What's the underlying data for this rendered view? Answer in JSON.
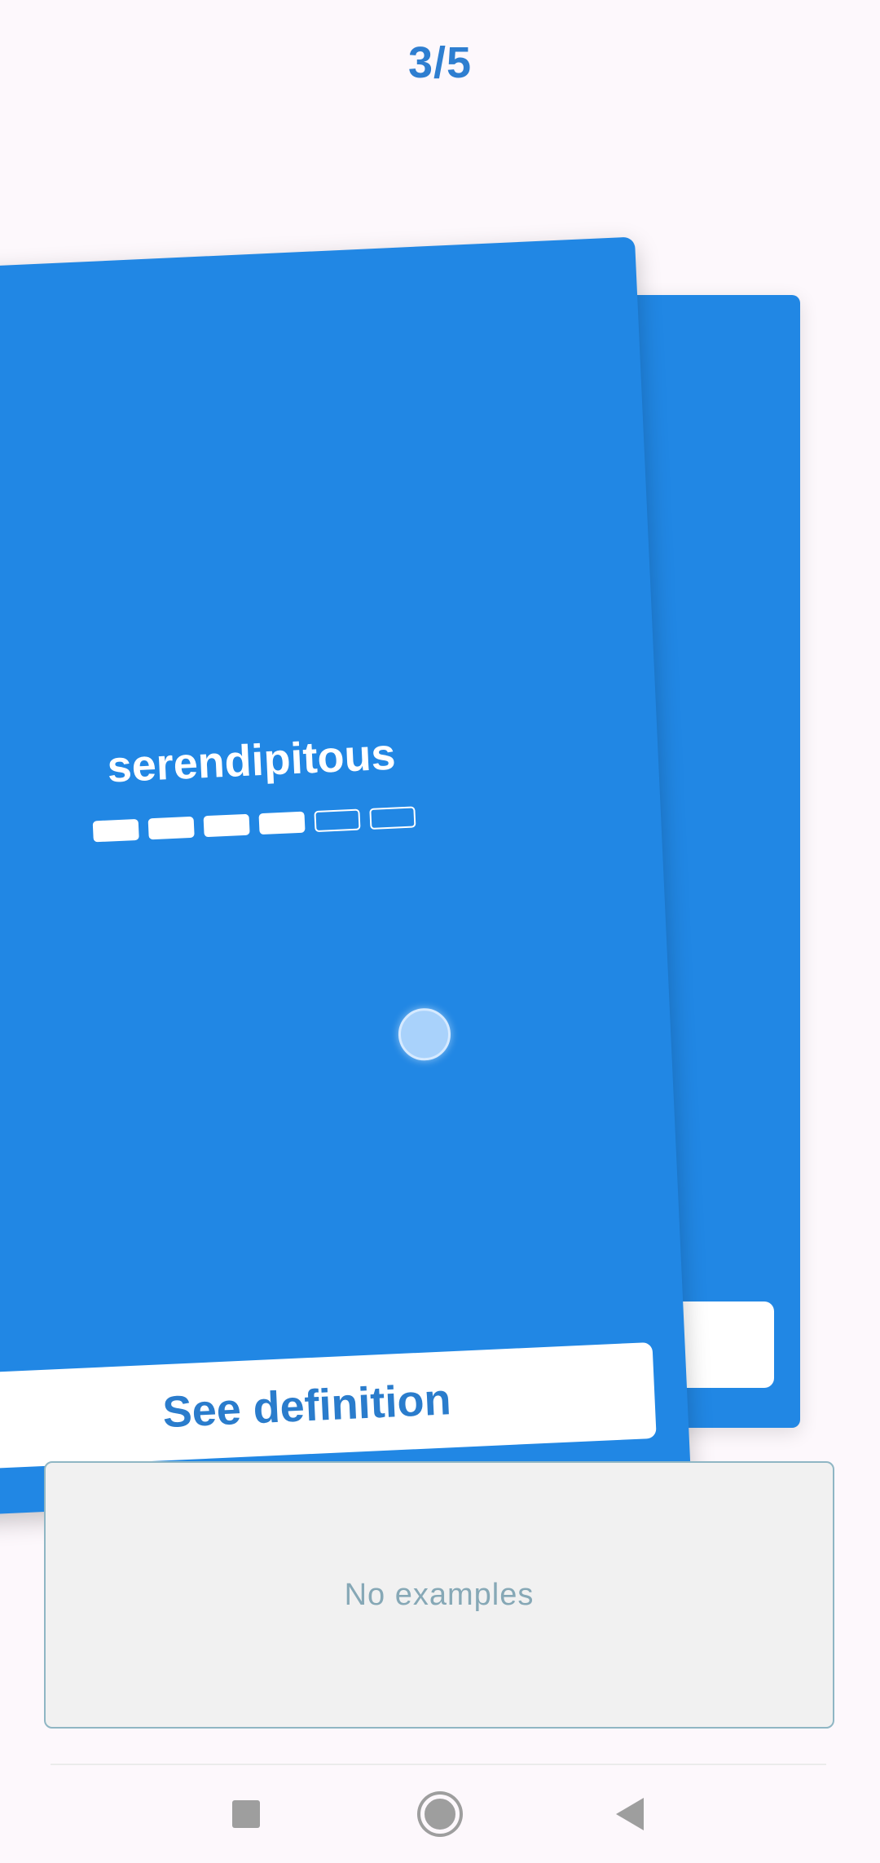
{
  "header": {
    "counter": "3/5"
  },
  "card": {
    "word": "serendipitous",
    "progress_filled": 4,
    "progress_total": 6,
    "see_definition_label": "See definition"
  },
  "examples": {
    "empty_text": "No examples"
  },
  "navbar": {
    "recents_icon": "square-icon",
    "home_icon": "circle-icon",
    "back_icon": "triangle-back-icon"
  },
  "colors": {
    "card_blue": "#2187e4",
    "accent_text": "#2e7ed0",
    "background": "#fdf8fc"
  }
}
